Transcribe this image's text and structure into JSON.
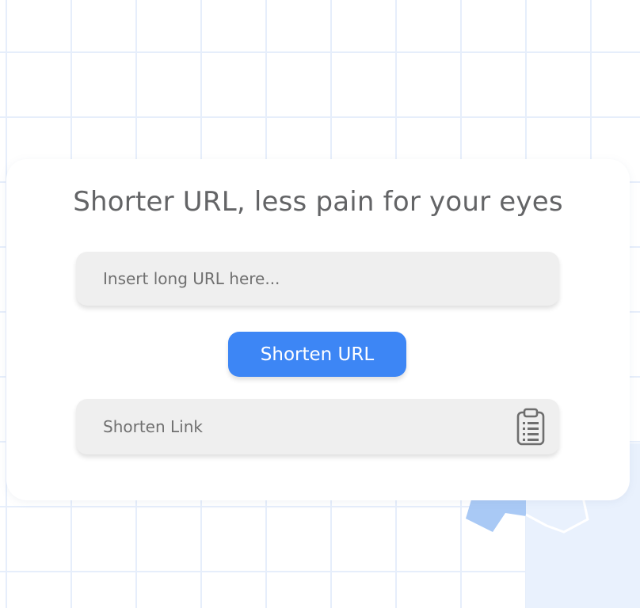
{
  "card": {
    "title": "Shorter URL, less pain for your eyes"
  },
  "url_input": {
    "value": "",
    "placeholder": "Insert long URL here..."
  },
  "shorten_button": {
    "label": "Shorten URL"
  },
  "result": {
    "value": "",
    "placeholder": "Shorten Link",
    "copy_icon": "clipboard-icon"
  },
  "colors": {
    "accent": "#3d86f5",
    "title_text": "#636466",
    "field_bg": "#efefef",
    "grid_line": "#e6eefb"
  }
}
